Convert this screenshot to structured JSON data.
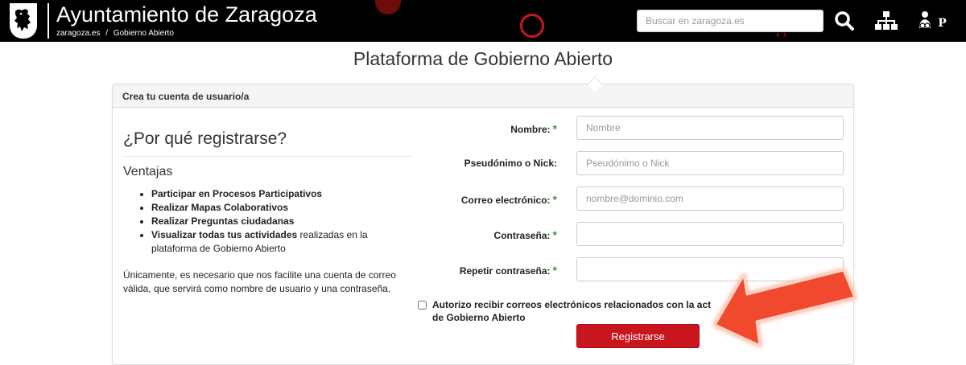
{
  "header": {
    "site_title": "Ayuntamiento de Zaragoza",
    "breadcrumb": {
      "home": "zaragoza.es",
      "separator": "/",
      "current": "Gobierno Abierto"
    },
    "search_placeholder": "Buscar en zaragoza.es",
    "icons": [
      "search-icon",
      "sitemap-icon",
      "accessibility-icon"
    ],
    "accessibility_letter": "P"
  },
  "page": {
    "title": "Plataforma de Gobierno Abierto"
  },
  "panel": {
    "heading": "Crea tu cuenta de usuario/a",
    "why_title": "¿Por qué registrarse?",
    "advantages_title": "Ventajas",
    "advantages": [
      {
        "bold": "Participar en Procesos Participativos",
        "rest": ""
      },
      {
        "bold": "Realizar Mapas Colaborativos",
        "rest": ""
      },
      {
        "bold": "Realizar Preguntas ciudadanas",
        "rest": ""
      },
      {
        "bold": "Visualizar todas tus actividades",
        "rest": " realizadas en la plataforma de Gobierno Abierto"
      }
    ],
    "note": "Únicamente, es necesario que nos facilite una cuenta de correo válida, que servirá como nombre de usuario y una contraseña."
  },
  "form": {
    "required_mark": "*",
    "fields": [
      {
        "label": "Nombre:",
        "placeholder": "Nombre",
        "required": true
      },
      {
        "label": "Pseudónimo o Nick:",
        "placeholder": "Pseudónimo o Nick",
        "required": false
      },
      {
        "label": "Correo electrónico:",
        "placeholder": "nombre@dominio.com",
        "required": true
      },
      {
        "label": "Contraseña:",
        "placeholder": "",
        "required": true
      },
      {
        "label": "Repetir contraseña:",
        "placeholder": "",
        "required": true
      }
    ],
    "consent_label": "Autorizo recibir correos electrónicos relacionados con la act... de Gobierno Abierto",
    "consent_line1": "Autorizo recibir correos electrónicos relacionados con la act",
    "consent_line2": "de Gobierno Abierto",
    "submit_label": "Registrarse"
  },
  "colors": {
    "brand_red": "#c9151d",
    "header_bg": "#000000",
    "required_green": "#3c9a3c",
    "arrow": "#f04a2f"
  }
}
